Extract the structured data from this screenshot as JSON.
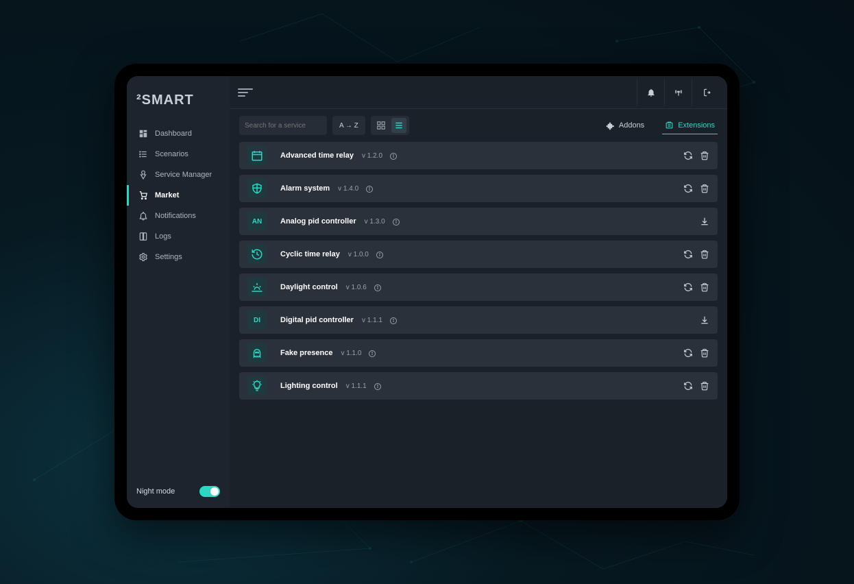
{
  "brand": "²SMART",
  "sidebar": {
    "items": [
      {
        "label": "Dashboard",
        "icon": "dashboard-icon"
      },
      {
        "label": "Scenarios",
        "icon": "scenarios-icon"
      },
      {
        "label": "Service Manager",
        "icon": "service-icon"
      },
      {
        "label": "Market",
        "icon": "cart-icon",
        "active": true
      },
      {
        "label": "Notifications",
        "icon": "bell-icon"
      },
      {
        "label": "Logs",
        "icon": "logs-icon"
      },
      {
        "label": "Settings",
        "icon": "gear-icon"
      }
    ],
    "night_mode_label": "Night mode",
    "night_mode_on": true
  },
  "search": {
    "placeholder": "Search for a service"
  },
  "sort_label": "A → Z",
  "tabs": {
    "addons_label": "Addons",
    "extensions_label": "Extensions",
    "active": "extensions"
  },
  "extensions": [
    {
      "name": "Advanced time relay",
      "version": "v 1.2.0",
      "icon": "calendar-icon",
      "actions": [
        "refresh",
        "delete"
      ]
    },
    {
      "name": "Alarm system",
      "version": "v 1.4.0",
      "icon": "shield-icon",
      "actions": [
        "refresh",
        "delete"
      ]
    },
    {
      "name": "Analog pid controller",
      "version": "v 1.3.0",
      "icon_text": "AN",
      "actions": [
        "download"
      ]
    },
    {
      "name": "Cyclic time relay",
      "version": "v 1.0.0",
      "icon": "history-icon",
      "actions": [
        "refresh",
        "delete"
      ]
    },
    {
      "name": "Daylight control",
      "version": "v 1.0.6",
      "icon": "sunrise-icon",
      "actions": [
        "refresh",
        "delete"
      ]
    },
    {
      "name": "Digital pid controller",
      "version": "v 1.1.1",
      "icon_text": "DI",
      "actions": [
        "download"
      ]
    },
    {
      "name": "Fake presence",
      "version": "v 1.1.0",
      "icon": "ghost-icon",
      "actions": [
        "refresh",
        "delete"
      ]
    },
    {
      "name": "Lighting control",
      "version": "v 1.1.1",
      "icon": "bulb-icon",
      "actions": [
        "refresh",
        "delete"
      ]
    }
  ],
  "colors": {
    "accent": "#2fd6c4",
    "panel": "#2a313b"
  }
}
